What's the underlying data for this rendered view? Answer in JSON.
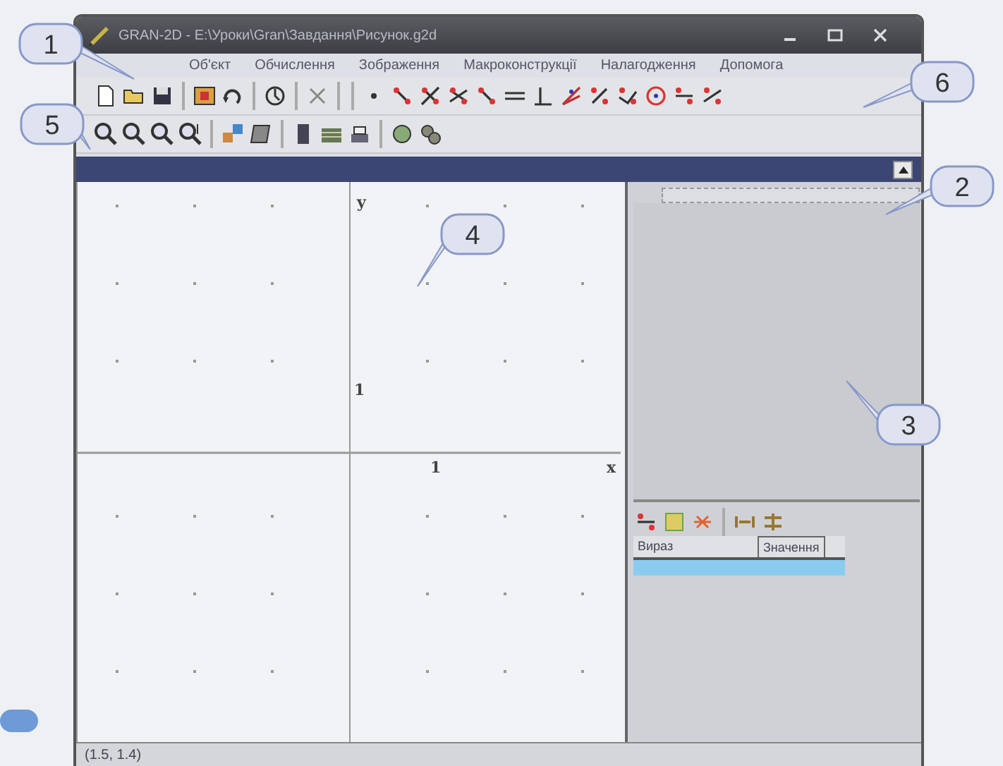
{
  "window": {
    "title": "GRAN-2D - E:\\Уроки\\Gran\\Завдання\\Рисунок.g2d"
  },
  "menu": [
    {
      "label": "Об'єкт"
    },
    {
      "label": "Обчислення"
    },
    {
      "label": "Зображення"
    },
    {
      "label": "Макроконструкції"
    },
    {
      "label": "Налагодження"
    },
    {
      "label": "Допомога"
    }
  ],
  "canvas": {
    "y_label": "y",
    "x_label": "x",
    "y_tick": "1",
    "x_tick": "1"
  },
  "expression_table": {
    "columns": [
      "Вираз",
      "Значення"
    ],
    "rows": [
      {
        "selected": true
      }
    ]
  },
  "status_bar": "(1.5, 1.4)",
  "callouts": [
    {
      "label": "1"
    },
    {
      "label": "2"
    },
    {
      "label": "3"
    },
    {
      "label": "4"
    },
    {
      "label": "5"
    },
    {
      "label": "6"
    }
  ]
}
